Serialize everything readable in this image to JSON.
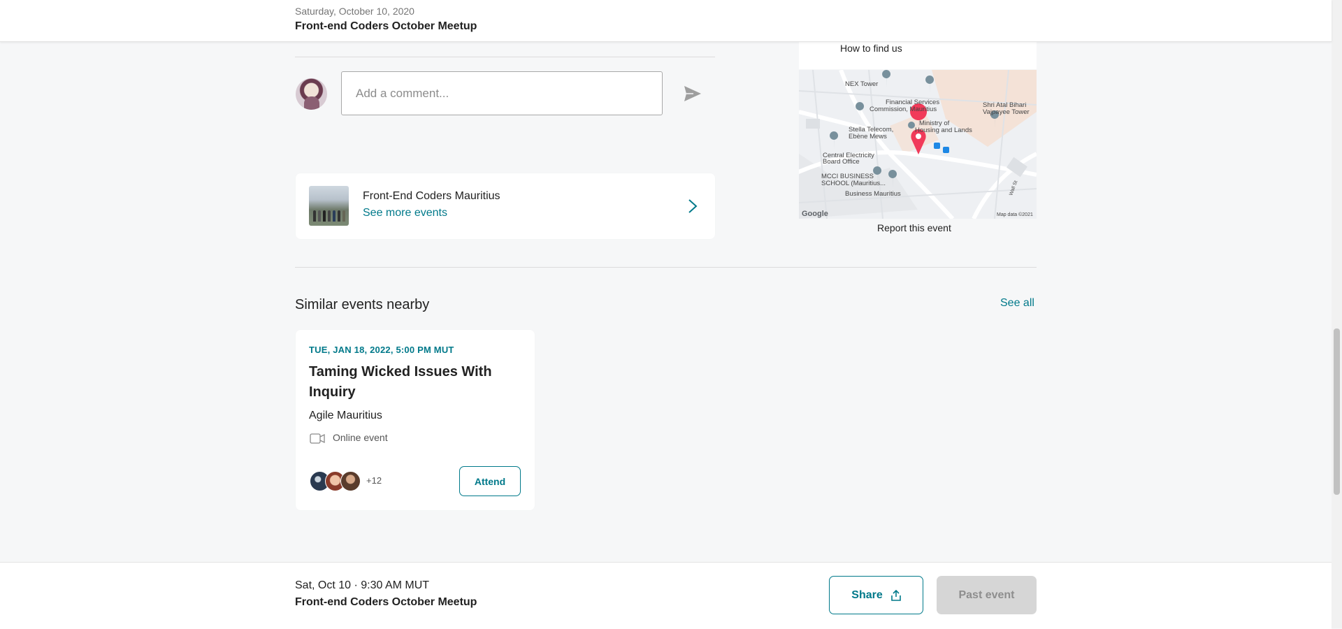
{
  "header": {
    "date": "Saturday, October 10, 2020",
    "title": "Front-end Coders October Meetup"
  },
  "comment": {
    "placeholder": "Add a comment..."
  },
  "group_card": {
    "name": "Front-End Coders Mauritius",
    "link": "See more events"
  },
  "map": {
    "heading": "How to find us",
    "report_label": "Report this event",
    "labels": {
      "nex": "NEX Tower",
      "fsc1": "Financial Services",
      "fsc2": "Commission, Mauritius",
      "shri1": "Shri Atal Bihari",
      "shri2": "Vajpayee Tower",
      "stella1": "Stella Telecom,",
      "stella2": "Ebène Mews",
      "ministry1": "Ministry of",
      "ministry2": "Housing and Lands",
      "ceb1": "Central Electricity",
      "ceb2": "Board Office",
      "mcci1": "MCCI BUSINESS",
      "mcci2": "SCHOOL (Mauritius...",
      "business": "Business Mauritius",
      "wall": "Wall St",
      "google": "Google",
      "mapdata": "Map data ©2021"
    }
  },
  "similar": {
    "title": "Similar events nearby",
    "see_all": "See all",
    "events": [
      {
        "date": "TUE, JAN 18, 2022, 5:00 PM MUT",
        "title": "Taming Wicked Issues With Inquiry",
        "group": "Agile Mauritius",
        "location": "Online event",
        "attendees_more": "+12",
        "attend_label": "Attend"
      }
    ]
  },
  "bottom_bar": {
    "time": "Sat, Oct 10 · 9:30 AM MUT",
    "title": "Front-end Coders October Meetup",
    "share_label": "Share",
    "past_label": "Past event"
  },
  "colors": {
    "accent": "#00798a",
    "pin": "#f13a59",
    "background": "#f6f7f8"
  }
}
